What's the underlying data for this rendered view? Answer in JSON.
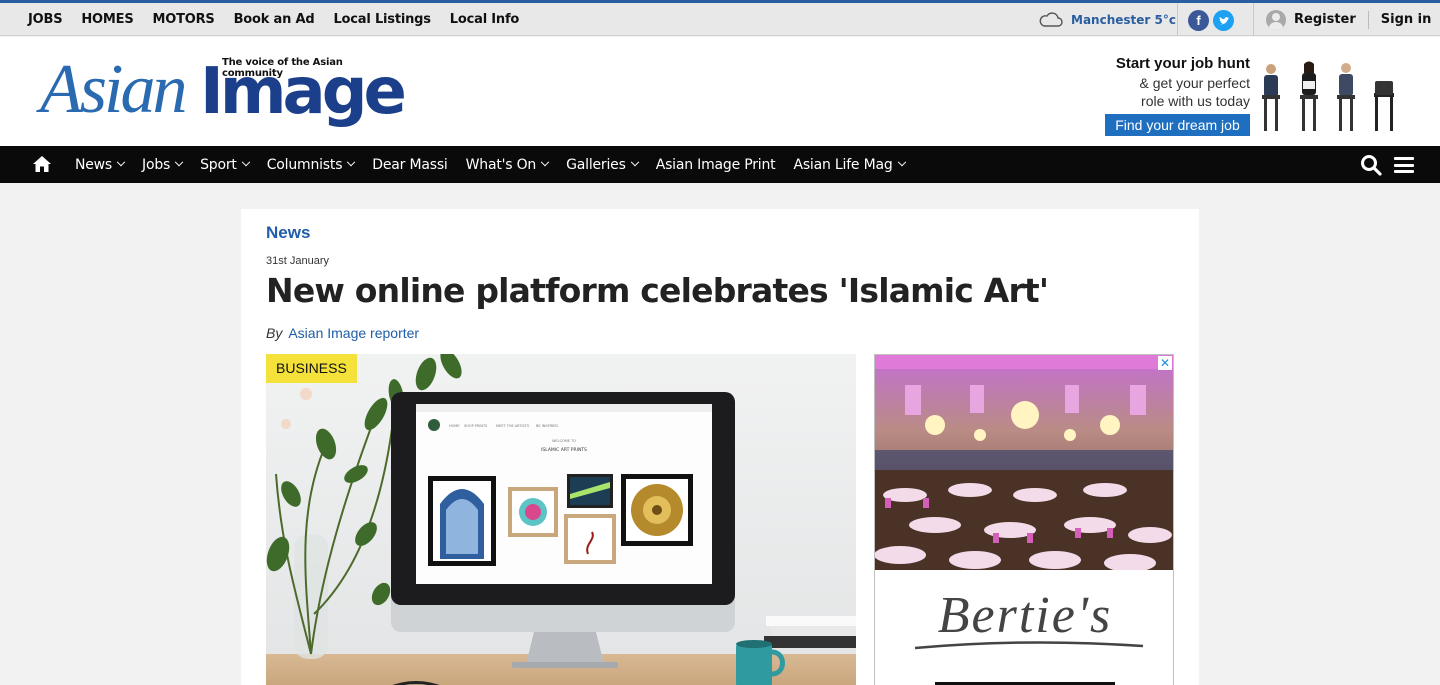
{
  "topbar": {
    "links": [
      "JOBS",
      "HOMES",
      "MOTORS",
      "Book an Ad",
      "Local Listings",
      "Local Info"
    ],
    "weather": "Manchester 5°c",
    "register": "Register",
    "signin": "Sign in"
  },
  "logo": {
    "tagline": "The voice of the Asian community",
    "word1": "Asian",
    "word2": "Image"
  },
  "jobad": {
    "line1": "Start your job hunt",
    "line2": "& get your perfect",
    "line3": "role with us today",
    "cta": "Find your dream job"
  },
  "nav": {
    "items": [
      {
        "label": "News",
        "chevron": true
      },
      {
        "label": "Jobs",
        "chevron": true
      },
      {
        "label": "Sport",
        "chevron": true
      },
      {
        "label": "Columnists",
        "chevron": true
      },
      {
        "label": "Dear Massi",
        "chevron": false
      },
      {
        "label": "What's On",
        "chevron": true
      },
      {
        "label": "Galleries",
        "chevron": true
      },
      {
        "label": "Asian Image Print",
        "chevron": false
      },
      {
        "label": "Asian Life Mag",
        "chevron": true
      }
    ]
  },
  "article": {
    "section": "News",
    "date": "31st January",
    "headline": "New online platform celebrates 'Islamic Art'",
    "byline_prefix": "By",
    "author": "Asian Image reporter",
    "badge": "BUSINESS"
  },
  "screen": {
    "nav": [
      "HOME",
      "SHOP PRINTS",
      "MEET THE ARTISTS",
      "BE INSPIRED"
    ],
    "welcome": "WELCOME TO",
    "site_title": "ISLAMIC ART PRINTS"
  },
  "ad": {
    "brand": "Bertie's",
    "close": "✕"
  },
  "colors": {
    "brand_blue": "#1f5ea8",
    "nav_bg": "#0a0a0a",
    "badge_yellow": "#f4e23a",
    "facebook": "#3b5998",
    "twitter": "#1da1f2"
  }
}
